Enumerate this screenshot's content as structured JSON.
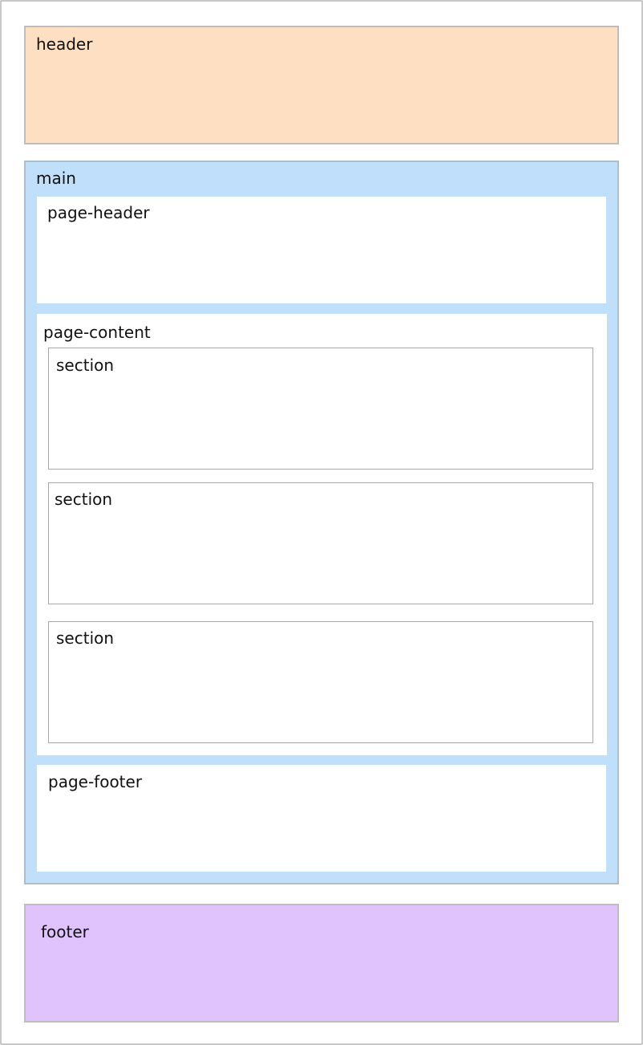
{
  "colors": {
    "header_fill": "#ffdfc2",
    "main_fill": "#bfdffb",
    "footer_fill": "#e0c2fd",
    "inner_fill": "#ffffff",
    "border": "#bdbdbd"
  },
  "header": {
    "label": "header"
  },
  "main": {
    "label": "main",
    "page_header": {
      "label": "page-header"
    },
    "page_content": {
      "label": "page-content",
      "sections": [
        {
          "label": "section"
        },
        {
          "label": "section"
        },
        {
          "label": "section"
        }
      ]
    },
    "page_footer": {
      "label": "page-footer"
    }
  },
  "footer": {
    "label": "footer"
  }
}
